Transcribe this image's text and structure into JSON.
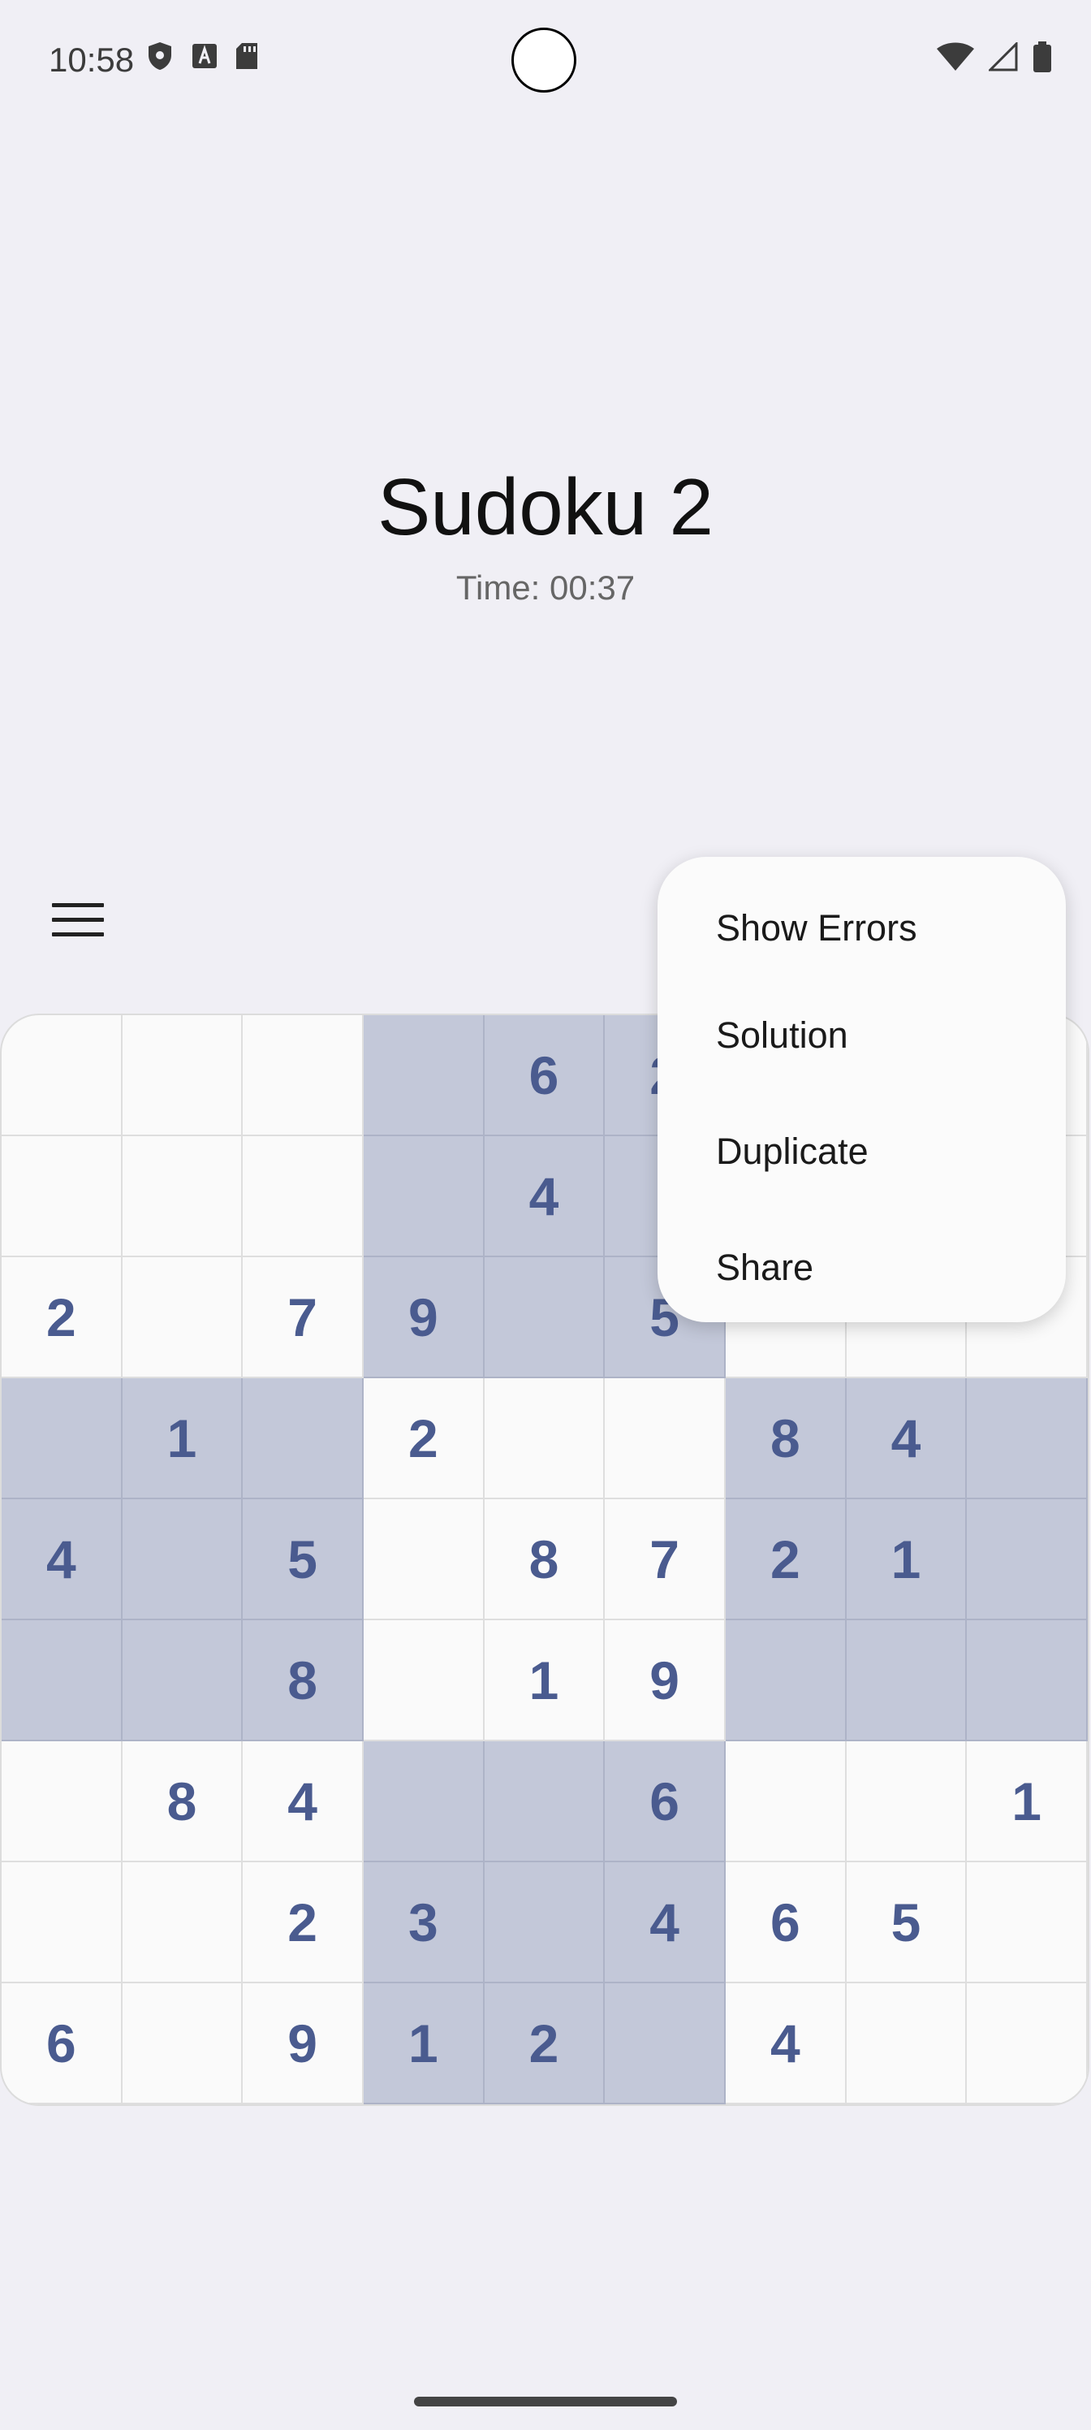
{
  "status_bar": {
    "time": "10:58",
    "left_icons": [
      "shield-icon",
      "font-a-icon",
      "sd-card-icon"
    ],
    "right_icons": [
      "wifi-icon",
      "signal-icon",
      "battery-icon"
    ]
  },
  "header": {
    "title": "Sudoku 2",
    "timer": "Time: 00:37"
  },
  "menu_button_icon": "hamburger-menu-icon",
  "board": {
    "values": [
      [
        "",
        "",
        "",
        "",
        "6",
        "2",
        "",
        "",
        ""
      ],
      [
        "",
        "",
        "",
        "",
        "4",
        "",
        "",
        "",
        ""
      ],
      [
        "2",
        "",
        "7",
        "9",
        "",
        "5",
        "",
        "",
        ""
      ],
      [
        "",
        "1",
        "",
        "2",
        "",
        "",
        "8",
        "4",
        ""
      ],
      [
        "4",
        "",
        "5",
        "",
        "8",
        "7",
        "2",
        "1",
        ""
      ],
      [
        "",
        "",
        "8",
        "",
        "1",
        "9",
        "",
        "",
        ""
      ],
      [
        "",
        "8",
        "4",
        "",
        "",
        "6",
        "",
        "",
        "1"
      ],
      [
        "",
        "",
        "2",
        "3",
        "",
        "4",
        "6",
        "5",
        ""
      ],
      [
        "6",
        "",
        "9",
        "1",
        "2",
        "",
        "4",
        "",
        ""
      ]
    ],
    "colors": {
      "cell_background": "#fafafa",
      "shaded_block": "#c3c8d9",
      "number_color": "#4a5b8f"
    }
  },
  "popup_menu": {
    "items": [
      "Show Errors",
      "Solution",
      "Duplicate",
      "Share"
    ]
  }
}
